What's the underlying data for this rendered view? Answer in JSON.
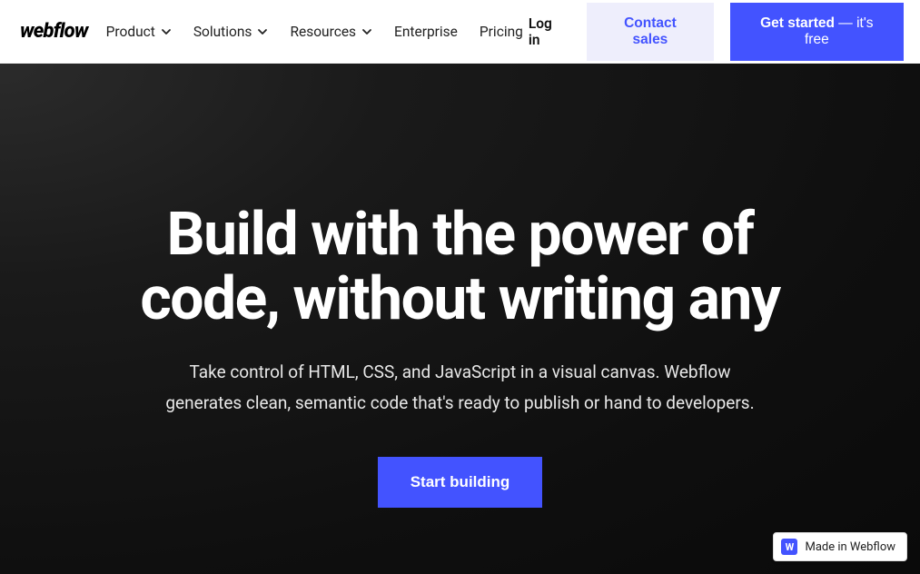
{
  "nav": {
    "logo": "webflow",
    "items": [
      {
        "label": "Product",
        "dropdown": true
      },
      {
        "label": "Solutions",
        "dropdown": true
      },
      {
        "label": "Resources",
        "dropdown": true
      },
      {
        "label": "Enterprise",
        "dropdown": false
      },
      {
        "label": "Pricing",
        "dropdown": false
      }
    ],
    "login": "Log in",
    "contact_sales": "Contact sales",
    "get_started": "Get started",
    "get_started_suffix": " — it's free"
  },
  "hero": {
    "headline": "Build with the power of code, without writing any",
    "subhead": "Take control of HTML, CSS, and JavaScript in a visual canvas. Webflow generates clean, semantic code that's ready to publish or hand to developers.",
    "cta": "Start building"
  },
  "badge": {
    "icon_letter": "W",
    "label": "Made in Webflow"
  }
}
